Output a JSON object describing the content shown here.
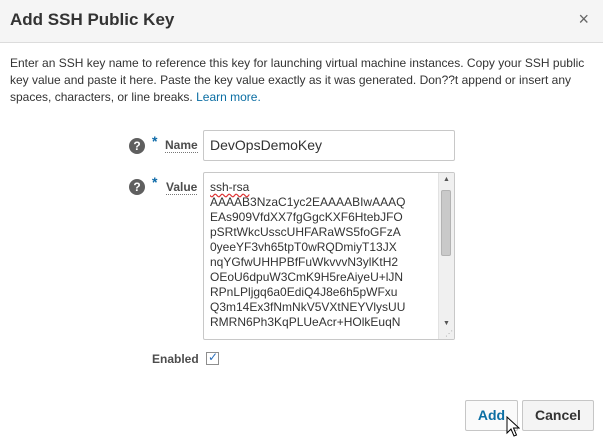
{
  "dialog": {
    "title": "Add SSH Public Key",
    "close_symbol": "×",
    "description": "Enter an SSH key name to reference this key for launching virtual machine instances. Copy your SSH public key value and paste it here. Paste the key value exactly as it was generated. Don??t append or insert any spaces, characters, or line breaks.",
    "learn_more": "Learn more."
  },
  "form": {
    "help_symbol": "?",
    "required_symbol": "*",
    "name_label": "Name",
    "name_value": "DevOpsDemoKey",
    "value_label": "Value",
    "value_first_line": "ssh-rsa",
    "value_rest": "AAAAB3NzaC1yc2EAAAABIwAAAQ\nEAs909VfdXX7fgGgcKXF6HtebJFO\npSRtWkcUsscUHFARaWS5foGFzA\n0yeeYF3vh65tpT0wRQDmiyT13JX\nnqYGfwUHHPBfFuWkvvvN3ylKtH2\nOEoU6dpuW3CmK9H5reAiyeU+lJN\nRPnLPljgq6a0EdiQ4J8e6h5pWFxu\nQ3m14Ex3fNmNkV5VXtNEYVlysUU\nRMRN6Ph3KqPLUeAcr+HOlkEuqN",
    "enabled_label": "Enabled",
    "enabled_checked": true
  },
  "buttons": {
    "add_label": "Add",
    "cancel_label": "Cancel"
  },
  "colors": {
    "accent": "#0b6ea3",
    "required": "#0d6aa8"
  }
}
